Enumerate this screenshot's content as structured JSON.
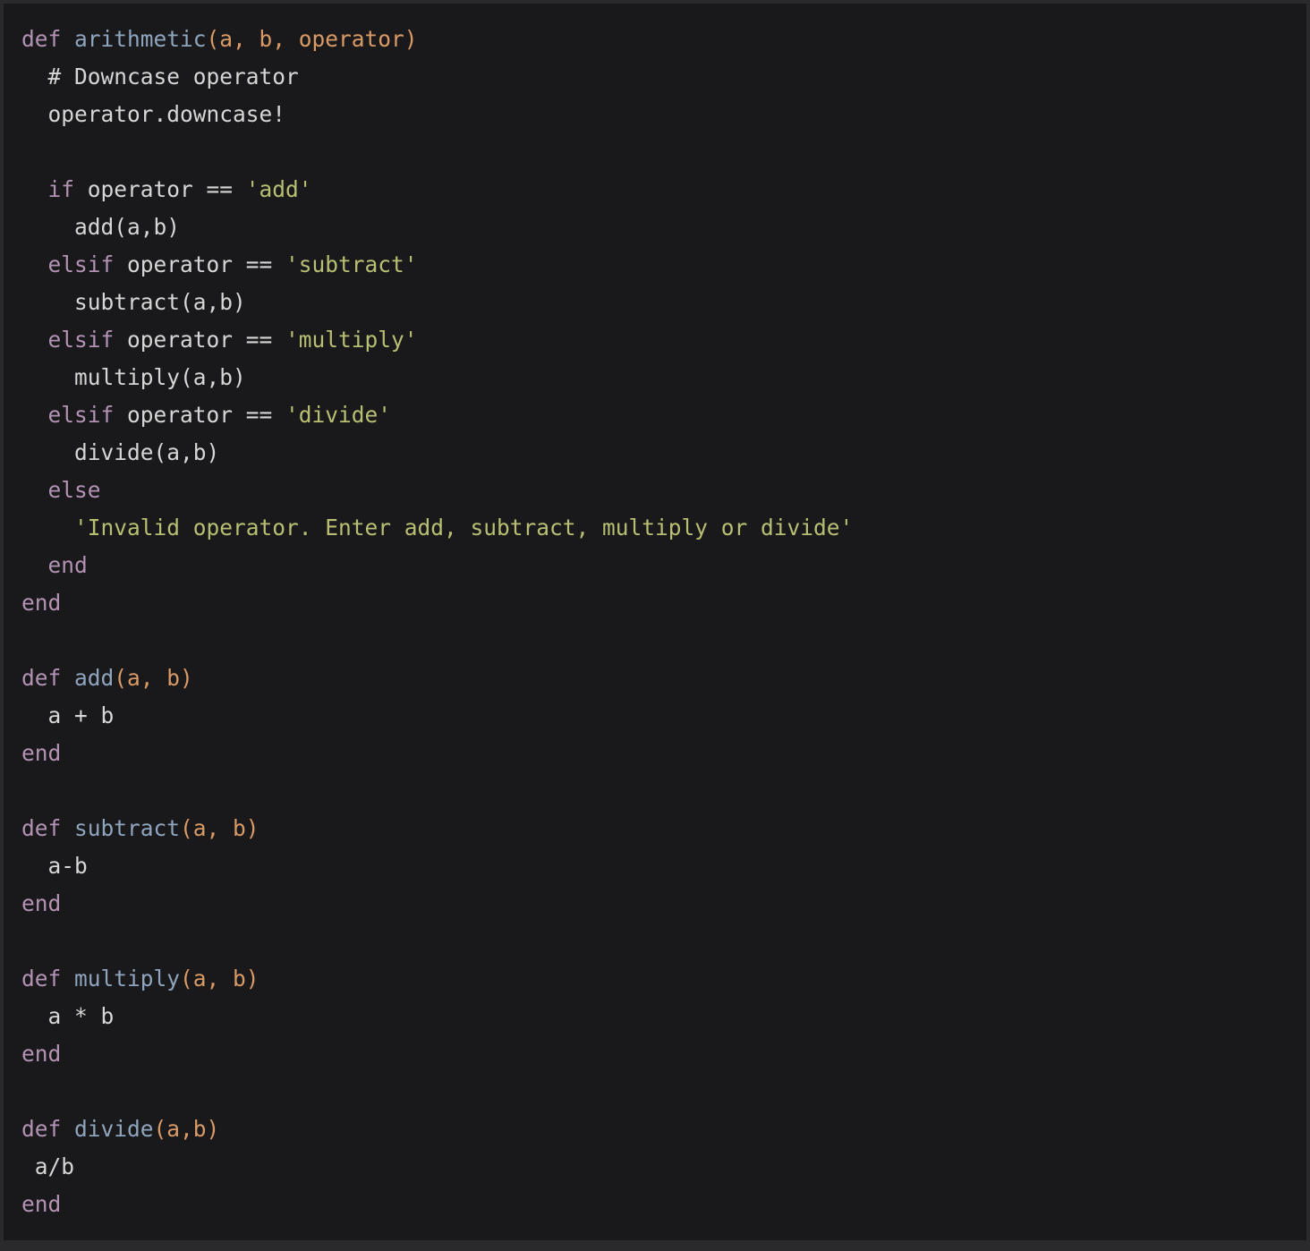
{
  "colors": {
    "background": "#19191b",
    "border": "#2a2a2c",
    "keyword": "#b392b3",
    "function": "#8fa5bd",
    "parameter": "#d99a66",
    "string": "#b9bf72",
    "text": "#d6d6d6"
  },
  "code": {
    "language": "ruby",
    "lines": [
      [
        {
          "t": "keyword",
          "v": "def"
        },
        {
          "t": "plain",
          "v": " "
        },
        {
          "t": "function",
          "v": "arithmetic"
        },
        {
          "t": "param",
          "v": "(a, b, operator)"
        }
      ],
      [
        {
          "t": "plain",
          "v": "  "
        },
        {
          "t": "comment",
          "v": "# Downcase operator"
        }
      ],
      [
        {
          "t": "plain",
          "v": "  operator.downcase!"
        }
      ],
      [],
      [
        {
          "t": "plain",
          "v": "  "
        },
        {
          "t": "keyword",
          "v": "if"
        },
        {
          "t": "plain",
          "v": " operator == "
        },
        {
          "t": "string",
          "v": "'add'"
        }
      ],
      [
        {
          "t": "plain",
          "v": "    add(a,b)"
        }
      ],
      [
        {
          "t": "plain",
          "v": "  "
        },
        {
          "t": "keyword",
          "v": "elsif"
        },
        {
          "t": "plain",
          "v": " operator == "
        },
        {
          "t": "string",
          "v": "'subtract'"
        }
      ],
      [
        {
          "t": "plain",
          "v": "    subtract(a,b)"
        }
      ],
      [
        {
          "t": "plain",
          "v": "  "
        },
        {
          "t": "keyword",
          "v": "elsif"
        },
        {
          "t": "plain",
          "v": " operator == "
        },
        {
          "t": "string",
          "v": "'multiply'"
        }
      ],
      [
        {
          "t": "plain",
          "v": "    multiply(a,b)"
        }
      ],
      [
        {
          "t": "plain",
          "v": "  "
        },
        {
          "t": "keyword",
          "v": "elsif"
        },
        {
          "t": "plain",
          "v": " operator == "
        },
        {
          "t": "string",
          "v": "'divide'"
        }
      ],
      [
        {
          "t": "plain",
          "v": "    divide(a,b)"
        }
      ],
      [
        {
          "t": "plain",
          "v": "  "
        },
        {
          "t": "keyword",
          "v": "else"
        }
      ],
      [
        {
          "t": "plain",
          "v": "    "
        },
        {
          "t": "string",
          "v": "'Invalid operator. Enter add, subtract, multiply or divide'"
        }
      ],
      [
        {
          "t": "plain",
          "v": "  "
        },
        {
          "t": "keyword",
          "v": "end"
        }
      ],
      [
        {
          "t": "keyword",
          "v": "end"
        }
      ],
      [],
      [
        {
          "t": "keyword",
          "v": "def"
        },
        {
          "t": "plain",
          "v": " "
        },
        {
          "t": "function",
          "v": "add"
        },
        {
          "t": "param",
          "v": "(a, b)"
        }
      ],
      [
        {
          "t": "plain",
          "v": "  a + b"
        }
      ],
      [
        {
          "t": "keyword",
          "v": "end"
        }
      ],
      [],
      [
        {
          "t": "keyword",
          "v": "def"
        },
        {
          "t": "plain",
          "v": " "
        },
        {
          "t": "function",
          "v": "subtract"
        },
        {
          "t": "param",
          "v": "(a, b)"
        }
      ],
      [
        {
          "t": "plain",
          "v": "  a-b"
        }
      ],
      [
        {
          "t": "keyword",
          "v": "end"
        }
      ],
      [],
      [
        {
          "t": "keyword",
          "v": "def"
        },
        {
          "t": "plain",
          "v": " "
        },
        {
          "t": "function",
          "v": "multiply"
        },
        {
          "t": "param",
          "v": "(a, b)"
        }
      ],
      [
        {
          "t": "plain",
          "v": "  a * b"
        }
      ],
      [
        {
          "t": "keyword",
          "v": "end"
        }
      ],
      [],
      [
        {
          "t": "keyword",
          "v": "def"
        },
        {
          "t": "plain",
          "v": " "
        },
        {
          "t": "function",
          "v": "divide"
        },
        {
          "t": "param",
          "v": "(a,b)"
        }
      ],
      [
        {
          "t": "plain",
          "v": " a/b"
        }
      ],
      [
        {
          "t": "keyword",
          "v": "end"
        }
      ]
    ]
  }
}
